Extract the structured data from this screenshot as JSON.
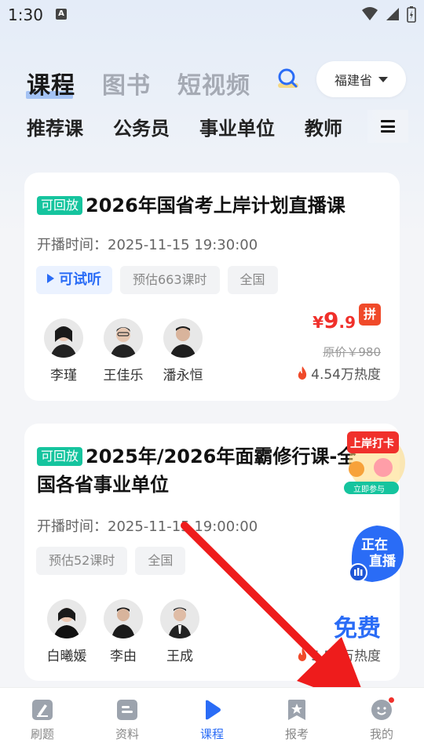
{
  "status_bar": {
    "time": "1:30",
    "notif": "A"
  },
  "top_tabs": [
    {
      "label": "课程",
      "active": true
    },
    {
      "label": "图书",
      "active": false
    },
    {
      "label": "短视频",
      "active": false
    }
  ],
  "province": {
    "label": "福建省"
  },
  "category_tabs": [
    "推荐课",
    "公务员",
    "事业单位",
    "教师"
  ],
  "courses": [
    {
      "badge": "可回放",
      "title": "2026年国省考上岸计划直播课",
      "start_label": "开播时间：",
      "start_time": "2025-11-15 19:30:00",
      "tags": [
        "可试听",
        "预估663课时",
        "全国"
      ],
      "teachers": [
        "李瑾",
        "王佳乐",
        "潘永恒"
      ],
      "price_yen": "¥",
      "price_int": "9",
      "price_dec": ".9",
      "pin": "拼",
      "original_price": "原价￥980",
      "heat": "4.54万热度"
    },
    {
      "badge": "可回放",
      "title_line1": "2025年/2026年面霸修行课-全",
      "title_line2": "国各省事业单位",
      "start_label": "开播时间：",
      "start_time": "2025-11-15 19:00:00",
      "tags": [
        "预估52课时",
        "全国"
      ],
      "teachers": [
        "白曦媛",
        "李由",
        "王成"
      ],
      "price_free": "免费",
      "heat": "5.53万热度"
    }
  ],
  "promo": {
    "line1": "上岸打卡",
    "line2": "立即参与"
  },
  "live_float": {
    "line1": "正在",
    "line2": "直播"
  },
  "bottom_nav": [
    {
      "label": "刷题",
      "active": false
    },
    {
      "label": "资料",
      "active": false
    },
    {
      "label": "课程",
      "active": true
    },
    {
      "label": "报考",
      "active": false
    },
    {
      "label": "我的",
      "active": false
    }
  ],
  "colors": {
    "accent": "#2a6cf6",
    "price": "#f0302b",
    "replay": "#15c49e",
    "arrow": "#ee1c1c"
  }
}
